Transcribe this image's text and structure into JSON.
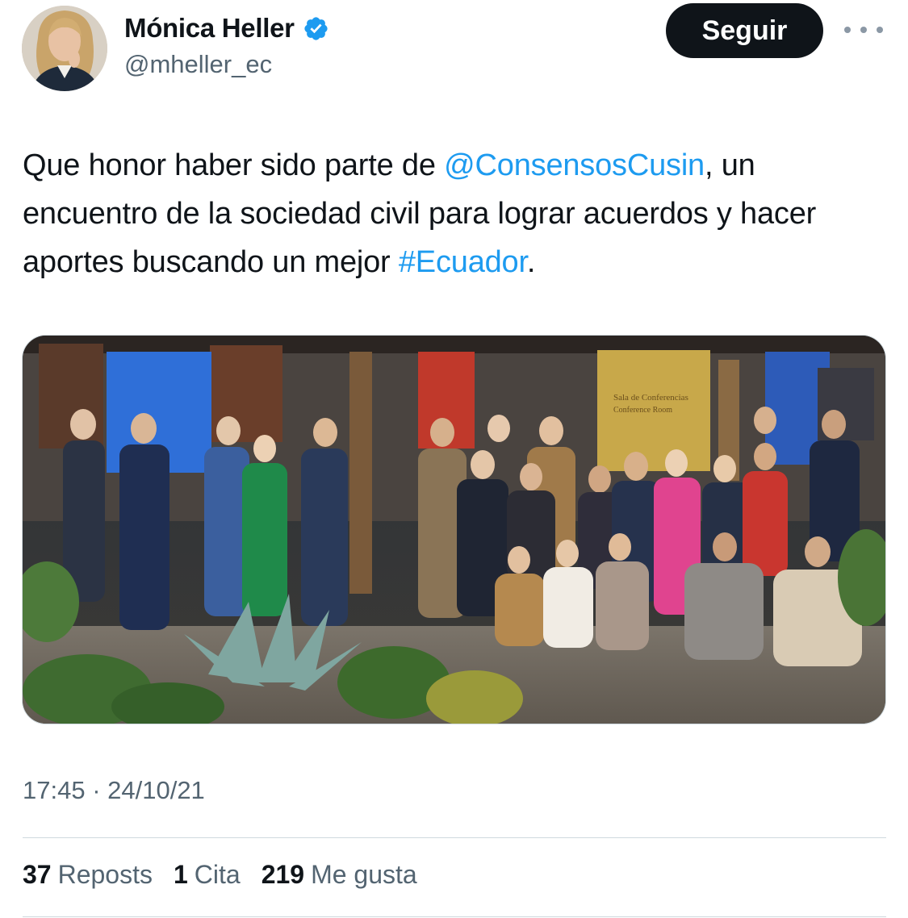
{
  "author": {
    "name": "Mónica Heller",
    "handle": "@mheller_ec",
    "avatar_icon": "profile-photo",
    "verified_icon": "verified-badge-icon",
    "verified_color": "#1d9bf0"
  },
  "actions": {
    "follow_label": "Seguir",
    "more_icon": "more-horizontal-icon"
  },
  "tweet": {
    "text_part1": "Que honor haber sido parte de ",
    "mention": "@ConsensosCusin",
    "text_part2": ", un encuentro de la sociedad civil para lograr acuerdos y hacer aportes buscando un mejor ",
    "hashtag": "#Ecuador",
    "text_part3": ".",
    "link_color": "#1d9bf0"
  },
  "media": {
    "sign_line1": "Sala de Conferencias",
    "sign_line2": "Conference Room"
  },
  "meta": {
    "timestamp": "17:45 · 24/10/21"
  },
  "stats": {
    "reposts_count": "37",
    "reposts_label": "Reposts",
    "quotes_count": "1",
    "quotes_label": "Cita",
    "likes_count": "219",
    "likes_label": "Me gusta"
  }
}
